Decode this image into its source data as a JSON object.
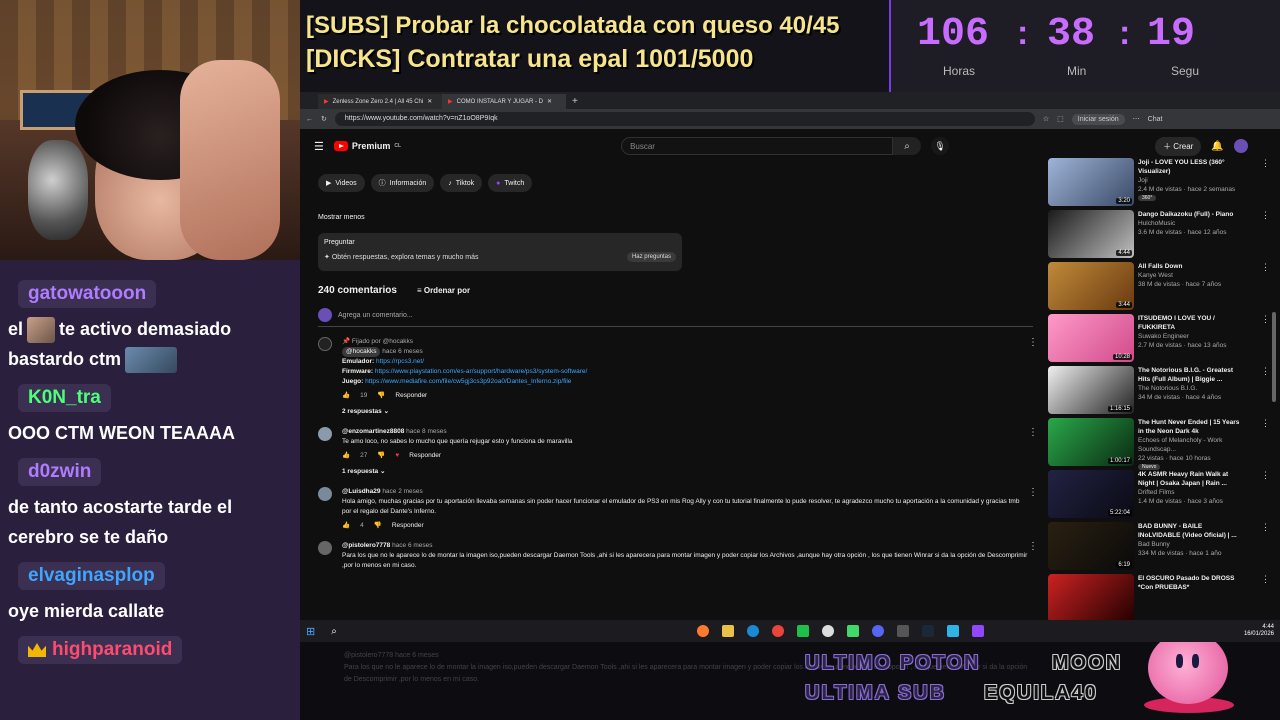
{
  "goals": {
    "line1": "[SUBS] Probar la chocolatada con queso 40/45",
    "line2": "[DICKS] Contratar una epal 1001/5000"
  },
  "timer": {
    "hours": "106",
    "minutes": "38",
    "seconds": "19",
    "hours_label": "Horas",
    "minutes_label": "Min",
    "seconds_label": "Segu",
    "separator": ":",
    "color": "#c86bff"
  },
  "chat": {
    "messages": [
      {
        "user": "gatowatooon",
        "color": "#b07cff",
        "text_a": "el",
        "text_b": "te activo demasiado",
        "text_c": "bastardo ctm"
      },
      {
        "user": "K0N_tra",
        "color": "#4cff7a",
        "text": "OOO CTM WEON TEAAAA"
      },
      {
        "user": "d0zwin",
        "color": "#b07cff",
        "text": "de tanto acostarte tarde el cerebro se te daño"
      },
      {
        "user": "elvaginasplop",
        "color": "#3ea6ff",
        "text": "oye mierda callate"
      },
      {
        "user": "highparanoid",
        "color": "#ff4b6e",
        "badge": "crown"
      }
    ]
  },
  "browser": {
    "tabs": [
      {
        "label": "Zenless Zone Zero 2.4 | All 45 Chi"
      },
      {
        "label": "COMO INSTALAR Y JUGAR - D"
      }
    ],
    "url": "https://www.youtube.com/watch?v=nZ1oO8P9Iqk",
    "signin": "Iniciar sesión",
    "chat_btn": "Chat"
  },
  "youtube": {
    "logo": "Premium",
    "logo_sup": "CL",
    "search_placeholder": "Buscar",
    "create": "Crear",
    "channel_tabs": [
      "Videos",
      "Información",
      "Tiktok",
      "Twitch"
    ],
    "show_less": "Mostrar menos",
    "ask": {
      "title": "Preguntar",
      "subtitle": "Obtén respuestas, explora temas y mucho más",
      "button": "Haz preguntas"
    },
    "comments_count": "240 comentarios",
    "sort": "Ordenar por",
    "add_comment": "Agrega un comentario...",
    "comments": [
      {
        "pinned": "Fijado por @hocakks",
        "author": "@hocakks",
        "time": "hace 6 meses",
        "lines": [
          {
            "label": "Emulador:",
            "link": "https://rpcs3.net/"
          },
          {
            "label": "Firmware:",
            "link": "https://www.playstation.com/es-ar/support/hardware/ps3/system-software/"
          },
          {
            "label": "Juego:",
            "link": "https://www.mediafire.com/file/cw5gj3cs3p92oa0/Dantes_Inferno.zip/file"
          }
        ],
        "likes": "19",
        "reply": "Responder",
        "replies": "2 respuestas"
      },
      {
        "author": "@enzomartinez8808",
        "time": "hace 8 meses",
        "text": "Te amo loco, no sabes lo mucho que quería rejugar esto y funciona de maravilla",
        "likes": "27",
        "reply": "Responder",
        "replies": "1 respuesta"
      },
      {
        "author": "@Luisdha29",
        "time": "hace 2 meses",
        "text": "Hola amigo, muchas gracias por tu aportación llevaba semanas sin poder hacer funcionar el emulador de PS3 en mis Rog Ally y con tu tutorial finalmente lo pude resolver, te agradezco mucho tu aportación a la comunidad y gracias tmb por el regalo del Dante's Inferno.",
        "likes": "4",
        "reply": "Responder"
      },
      {
        "author": "@pistolero7778",
        "time": "hace 6 meses",
        "text": "Para los que no le aparece lo de montar la imagen iso,pueden descargar Daemon Tools ,ahi si les aparecera para montar imagen y poder copiar los Archivos ,aunque hay otra opción , los que tienen Winrar si da la opción de Descomprimir ,por lo menos en mi caso."
      }
    ],
    "sidebar": [
      {
        "title": "Joji - LOVE YOU LESS (360° Visualizer)",
        "channel": "Joji",
        "meta": "2.4 M de vistas · hace 2 semanas",
        "badge": "360°",
        "dur": "3:20",
        "c1": "#9fb4d8",
        "c2": "#3a4a66"
      },
      {
        "title": "Dango Daikazoku (Full) - Piano",
        "channel": "HulchoMusic",
        "meta": "3.6 M de vistas · hace 12 años",
        "dur": "4:44",
        "c1": "#1a1a1a",
        "c2": "#c0c0c0"
      },
      {
        "title": "All Falls Down",
        "channel": "Kanye West",
        "meta": "38 M de vistas · hace 7 años",
        "dur": "3:44",
        "c1": "#c08a3a",
        "c2": "#6a3a10"
      },
      {
        "title": "ITSUDEMO I LOVE YOU / FUKKIRETA",
        "channel": "Suwako Engineer",
        "meta": "2.7 M de vistas · hace 13 años",
        "dur": "10:28",
        "c1": "#ff9ac8",
        "c2": "#d04a8a"
      },
      {
        "title": "The Notorious B.I.G. - Greatest Hits (Full Album) | Biggie ...",
        "channel": "The Notorious B.I.G.",
        "meta": "34 M de vistas · hace 4 años",
        "dur": "1:16:15",
        "c1": "#f0f0f0",
        "c2": "#222222"
      },
      {
        "title": "The Hunt Never Ended | 15 Years in the Neon Dark 4k",
        "channel": "Echoes of Melancholy - Work Soundscap...",
        "meta": "22 vistas · hace 10 horas",
        "badge": "Nuevo",
        "dur": "1:00:17",
        "c1": "#2aa84a",
        "c2": "#0a2a12"
      },
      {
        "title": "4K ASMR Heavy Rain Walk at Night | Osaka Japan | Rain ...",
        "channel": "Drifted Films",
        "meta": "1.4 M de vistas · hace 3 años",
        "dur": "5:22:04",
        "c1": "#222244",
        "c2": "#0a0a14"
      },
      {
        "title": "BAD BUNNY - BAILE INoLVIDABLE (Video Oficial) | ...",
        "channel": "Bad Bunny",
        "meta": "334 M de vistas · hace 1 año",
        "dur": "6:19",
        "c1": "#2a2010",
        "c2": "#0a0a0a"
      },
      {
        "title": "El OSCURO Pasado De DROSS *Con PRUEBAS*",
        "channel": "",
        "meta": "",
        "dur": "",
        "c1": "#cc2222",
        "c2": "#220000"
      }
    ]
  },
  "taskbar": {
    "lang": "ESP\nAA",
    "time": "4:44",
    "date": "16/01/2026"
  },
  "overlay": {
    "line1": "ULTIMO POTON",
    "line2": "ULTIMA SUB",
    "right1": "MOON",
    "right2": "EQUILA40",
    "ghost1": "@pistolero7778 hace 6 meses",
    "ghost2": "Para los que no le aparece lo de montar la imagen iso,pueden descargar Daemon Tools ,ahi si les aparecera para montar imagen y poder copiar los Archivos ,aunque hay otra opción , los que tienen Winrar si da la opción",
    "ghost3": "de Descomprimir ,por lo menos en mi caso."
  }
}
